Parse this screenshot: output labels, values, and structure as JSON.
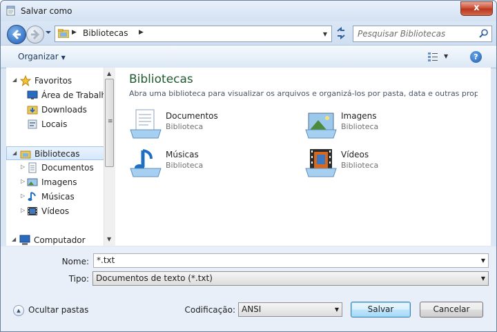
{
  "window": {
    "title": "Salvar como",
    "close_label": "x"
  },
  "nav": {
    "address_segment": "Bibliotecas",
    "search_placeholder": "Pesquisar Bibliotecas"
  },
  "toolbar": {
    "organize_label": "Organizar"
  },
  "tree": {
    "favorites": {
      "label": "Favoritos",
      "items": [
        {
          "label": "Área de Trabalho",
          "icon": "desktop-icon"
        },
        {
          "label": "Downloads",
          "icon": "downloads-folder-icon"
        },
        {
          "label": "Locais",
          "icon": "recent-places-icon"
        }
      ]
    },
    "libraries": {
      "label": "Bibliotecas",
      "items": [
        {
          "label": "Documentos",
          "icon": "documents-icon"
        },
        {
          "label": "Imagens",
          "icon": "pictures-icon"
        },
        {
          "label": "Músicas",
          "icon": "music-icon"
        },
        {
          "label": "Vídeos",
          "icon": "videos-icon"
        }
      ]
    },
    "computer": {
      "label": "Computador"
    }
  },
  "main": {
    "title": "Bibliotecas",
    "description": "Abra uma biblioteca para visualizar os arquivos e organizá-los por pasta, data e outras propri...",
    "libraries": [
      {
        "name": "Documentos",
        "type": "Biblioteca",
        "icon": "documents-library-icon"
      },
      {
        "name": "Imagens",
        "type": "Biblioteca",
        "icon": "pictures-library-icon"
      },
      {
        "name": "Músicas",
        "type": "Biblioteca",
        "icon": "music-library-icon"
      },
      {
        "name": "Vídeos",
        "type": "Biblioteca",
        "icon": "videos-library-icon"
      }
    ]
  },
  "form": {
    "name_label": "Nome:",
    "name_value": "*.txt",
    "type_label": "Tipo:",
    "type_value": "Documentos de texto (*.txt)",
    "encoding_label": "Codificação:",
    "encoding_value": "ANSI",
    "hide_folders_label": "Ocultar pastas",
    "save_label": "Salvar",
    "cancel_label": "Cancelar"
  }
}
